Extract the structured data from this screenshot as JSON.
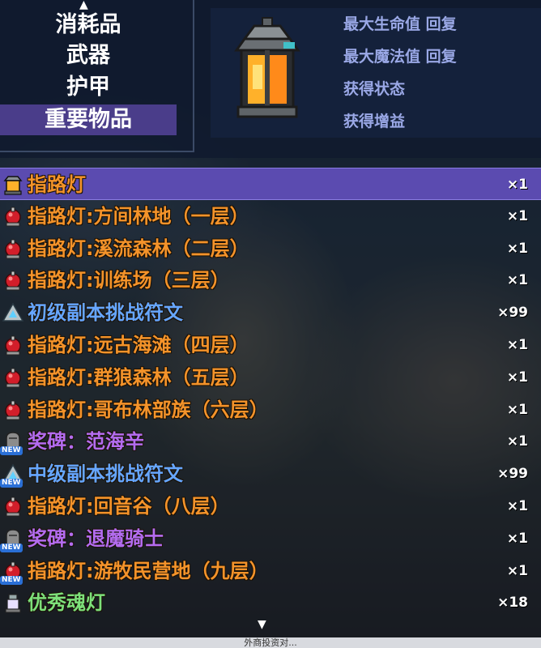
{
  "colors": {
    "orange_item": "#f4932a",
    "blue_item": "#66a6ff",
    "purple_item": "#b46cf0",
    "green_item": "#7de07a",
    "detail_text": "#9aa8e6",
    "selected_bg": "#5b4bb0"
  },
  "categories": [
    {
      "label": "消耗品",
      "active": false
    },
    {
      "label": "武器",
      "active": false
    },
    {
      "label": "护甲",
      "active": false
    },
    {
      "label": "重要物品",
      "active": true
    }
  ],
  "detail": {
    "icon": "lantern-icon",
    "lines": [
      "最大生命值 回复",
      "最大魔法值 回复",
      "获得状态",
      "获得增益"
    ]
  },
  "items": [
    {
      "name": "指路灯",
      "qty": "×1",
      "color": "orange",
      "icon": "lantern-icon",
      "selected": true,
      "new": false
    },
    {
      "name": "指路灯:方间林地（一层）",
      "qty": "×1",
      "color": "orange",
      "icon": "red-bell-icon",
      "selected": false,
      "new": false
    },
    {
      "name": "指路灯:溪流森林（二层）",
      "qty": "×1",
      "color": "orange",
      "icon": "red-bell-icon",
      "selected": false,
      "new": false
    },
    {
      "name": "指路灯:训练场（三层）",
      "qty": "×1",
      "color": "orange",
      "icon": "red-bell-icon",
      "selected": false,
      "new": false
    },
    {
      "name": "初级副本挑战符文",
      "qty": "×99",
      "color": "blue",
      "icon": "rune-stone-icon",
      "selected": false,
      "new": false
    },
    {
      "name": "指路灯:远古海滩（四层）",
      "qty": "×1",
      "color": "orange",
      "icon": "red-bell-icon",
      "selected": false,
      "new": false
    },
    {
      "name": "指路灯:群狼森林（五层）",
      "qty": "×1",
      "color": "orange",
      "icon": "red-bell-icon",
      "selected": false,
      "new": false
    },
    {
      "name": "指路灯:哥布林部族（六层）",
      "qty": "×1",
      "color": "orange",
      "icon": "red-bell-icon",
      "selected": false,
      "new": false
    },
    {
      "name": "奖碑：范海辛",
      "qty": "×1",
      "color": "purple",
      "icon": "tombstone-icon",
      "selected": false,
      "new": true
    },
    {
      "name": "中级副本挑战符文",
      "qty": "×99",
      "color": "blue",
      "icon": "rune-stone-icon",
      "selected": false,
      "new": true
    },
    {
      "name": "指路灯:回音谷（八层）",
      "qty": "×1",
      "color": "orange",
      "icon": "red-bell-icon",
      "selected": false,
      "new": false
    },
    {
      "name": "奖碑：退魔骑士",
      "qty": "×1",
      "color": "purple",
      "icon": "tombstone-icon",
      "selected": false,
      "new": true
    },
    {
      "name": "指路灯:游牧民营地（九层）",
      "qty": "×1",
      "color": "orange",
      "icon": "red-bell-icon",
      "selected": false,
      "new": true
    },
    {
      "name": "优秀魂灯",
      "qty": "×18",
      "color": "green",
      "icon": "soul-lamp-icon",
      "selected": false,
      "new": false
    }
  ],
  "badge_new": "NEW",
  "footer": "外商投资对..."
}
